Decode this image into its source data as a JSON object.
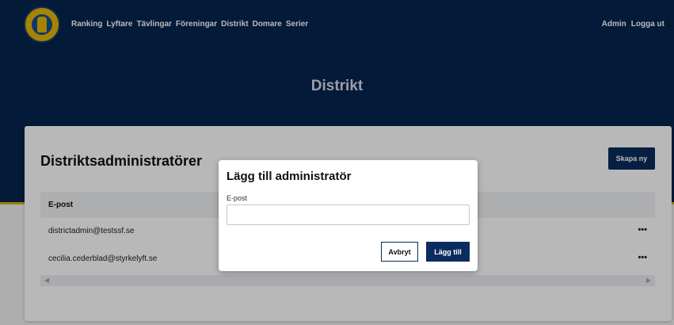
{
  "nav": {
    "links": [
      "Ranking",
      "Lyftare",
      "Tävlingar",
      "Föreningar",
      "Distrikt",
      "Domare",
      "Serier"
    ],
    "right": [
      "Admin",
      "Logga ut"
    ]
  },
  "hero": {
    "title": "Distrikt"
  },
  "card": {
    "title": "Distriktsadministratörer",
    "create_button": "Skapa ny",
    "column_header": "E-post",
    "rows": [
      {
        "email": "districtadmin@testssf.se",
        "menu": "•••"
      },
      {
        "email": "cecilia.cederblad@styrkelyft.se",
        "menu": "•••"
      }
    ],
    "scroll_left": "◀",
    "scroll_right": "▶"
  },
  "modal": {
    "title": "Lägg till administratör",
    "field_label": "E-post",
    "field_value": "",
    "cancel_label": "Avbryt",
    "submit_label": "Lägg till"
  },
  "colors": {
    "primary": "#0b2c5e",
    "hero_bg": "#05244f",
    "accent": "#d8b600"
  },
  "icons": {
    "logo": "federation-logo",
    "row_menu": "more-dots-icon"
  }
}
